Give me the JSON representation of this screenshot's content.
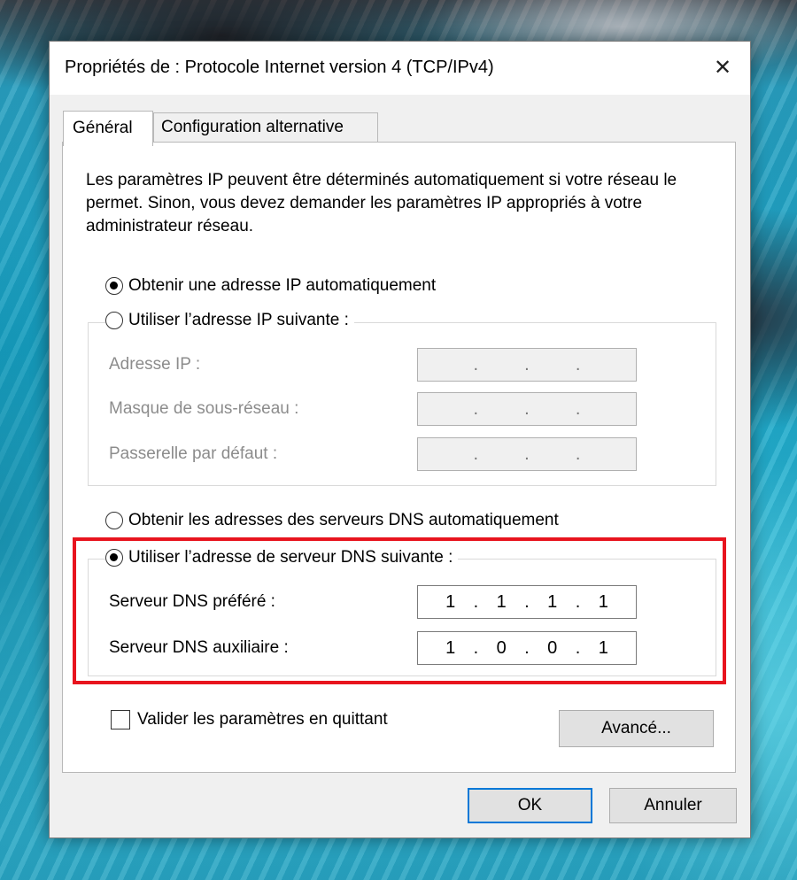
{
  "window": {
    "title": "Propriétés de : Protocole Internet version 4 (TCP/IPv4)",
    "close_glyph": "✕"
  },
  "tabs": [
    {
      "label": "Général",
      "selected": true
    },
    {
      "label": "Configuration alternative",
      "selected": false
    }
  ],
  "intro_text": "Les paramètres IP peuvent être déterminés automatiquement si votre réseau le permet. Sinon, vous devez demander les paramètres IP appropriés à votre administrateur réseau.",
  "ip_section": {
    "auto_label": "Obtenir une adresse IP automatiquement",
    "auto_selected": true,
    "manual_label": "Utiliser l’adresse IP suivante :",
    "manual_selected": false,
    "fields": [
      {
        "label": "Adresse IP :",
        "octets": [
          "",
          "",
          "",
          ""
        ]
      },
      {
        "label": "Masque de sous-réseau :",
        "octets": [
          "",
          "",
          "",
          ""
        ]
      },
      {
        "label": "Passerelle par défaut :",
        "octets": [
          "",
          "",
          "",
          ""
        ]
      }
    ]
  },
  "dns_section": {
    "auto_label": "Obtenir les adresses des serveurs DNS automatiquement",
    "auto_selected": false,
    "manual_label": "Utiliser l’adresse de serveur DNS suivante :",
    "manual_selected": true,
    "fields": [
      {
        "label": "Serveur DNS préféré :",
        "octets": [
          "1",
          "1",
          "1",
          "1"
        ]
      },
      {
        "label": "Serveur DNS auxiliaire :",
        "octets": [
          "1",
          "0",
          "0",
          "1"
        ]
      }
    ]
  },
  "octet_separator": ".",
  "validate_label": "Valider les paramètres en quittant",
  "validate_checked": false,
  "buttons": {
    "advanced": "Avancé...",
    "ok": "OK",
    "cancel": "Annuler"
  },
  "colors": {
    "highlight": "#e8141e",
    "default_button_border": "#0078d7"
  }
}
